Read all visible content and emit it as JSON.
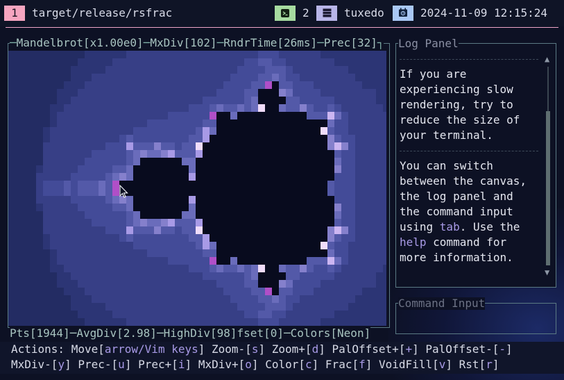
{
  "topbar": {
    "workspace_number": "1",
    "window_title": "target/release/rsfrac",
    "terminal_icon": "terminal-icon",
    "terminal_count": "2",
    "host_icon": "server-icon",
    "hostname": "tuxedo",
    "calendar_icon": "calendar-icon",
    "datetime": "2024-11-09 12:15:24"
  },
  "canvas": {
    "title_parts": [
      "Mandelbrot[x1.00e0]",
      "MxDiv[102]",
      "RndrTime[26ms]",
      "Prec[32]"
    ],
    "stats_parts": [
      "Pts[1944]",
      "AvgDiv[2.98]",
      "HighDiv[98]fset[0]",
      "Colors[Neon]"
    ]
  },
  "log_panel": {
    "title": "Log Panel",
    "para1": [
      "If you are",
      "experiencing slow",
      "rendering, try to",
      "reduce the size of",
      "your terminal."
    ],
    "para2_line1": "You can switch",
    "para2_line2": "between the canvas,",
    "para2_line3": "the log panel and",
    "para2_line4": "the command input",
    "para2_line5_pre": "using ",
    "para2_line5_key": "tab",
    "para2_line5_post": ". Use the",
    "para2_line6_key": "help",
    "para2_line6_post": " command for",
    "para2_line7": "more information."
  },
  "command_input": {
    "title": "Command Input",
    "value": ""
  },
  "actions": {
    "prefix": "Actions: ",
    "line1": [
      {
        "label": "Move",
        "key": "arrow/Vim keys"
      },
      {
        "label": "Zoom-",
        "key": "s"
      },
      {
        "label": "Zoom+",
        "key": "d"
      },
      {
        "label": "PalOffset+",
        "key": "+"
      },
      {
        "label": "PalOffset-",
        "key": "-"
      }
    ],
    "line2": [
      {
        "label": "MxDiv-",
        "key": "y"
      },
      {
        "label": "Prec-",
        "key": "u"
      },
      {
        "label": "Prec+",
        "key": "i"
      },
      {
        "label": "MxDiv+",
        "key": "o"
      },
      {
        "label": "Color",
        "key": "c"
      },
      {
        "label": "Frac",
        "key": "f"
      },
      {
        "label": "VoidFill",
        "key": "v"
      },
      {
        "label": "Rst",
        "key": "r"
      }
    ]
  },
  "colors": {
    "accent": "#a89ae6",
    "frame": "#5b7a84",
    "workspace": "#f6a5c0",
    "terminal": "#a6dba0",
    "host": "#b8b5e8",
    "calendar": "#a9c8f5"
  }
}
